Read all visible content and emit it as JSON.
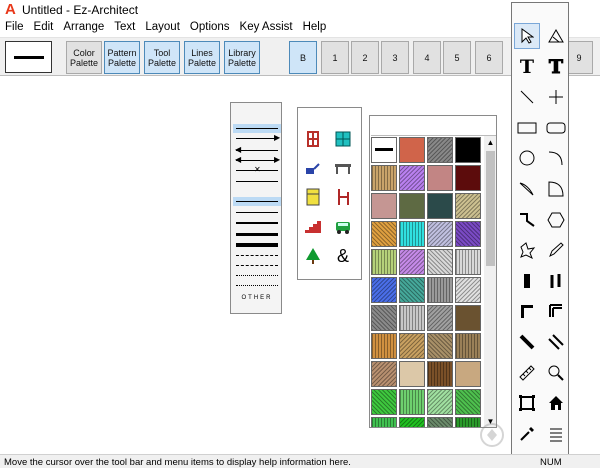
{
  "app": {
    "title": "Untitled - Ez-Architect",
    "icon_letter": "A"
  },
  "menu": [
    "File",
    "Edit",
    "Arrange",
    "Text",
    "Layout",
    "Options",
    "Key Assist",
    "Help"
  ],
  "toolbar": {
    "current_line_style": "thick-line",
    "palette_buttons": [
      {
        "label": "Color\nPalette",
        "selected": false
      },
      {
        "label": "Pattern\nPalette",
        "selected": true
      },
      {
        "label": "Tool\nPalette",
        "selected": true
      },
      {
        "label": "Lines\nPalette",
        "selected": true
      },
      {
        "label": "Library\nPalette",
        "selected": true
      }
    ],
    "layers": [
      {
        "label": "B",
        "selected": true
      },
      {
        "label": "1",
        "selected": false
      },
      {
        "label": "2",
        "selected": false
      },
      {
        "label": "3",
        "selected": false
      },
      {
        "label": "4",
        "selected": false
      },
      {
        "label": "5",
        "selected": false
      },
      {
        "label": "6",
        "selected": false
      },
      {
        "label": "9",
        "selected": false
      }
    ]
  },
  "lines_palette": {
    "other_label": "OTHER"
  },
  "library_palette": {
    "icons": [
      "door-icon",
      "window-icon",
      "sink-icon",
      "bench-icon",
      "refrigerator-icon",
      "chair-icon",
      "stairs-icon",
      "car-icon",
      "tree-icon",
      "ampersand-icon"
    ],
    "ampersand_text": "&"
  },
  "pattern_palette": {
    "colors": [
      "#ffffff",
      "#d0644a",
      "#888888",
      "#000000",
      "#c9a46a",
      "#b980f0",
      "#c28584",
      "#5c0c0c",
      "#c59693",
      "#5e6a43",
      "#2b4a4a",
      "#ccc090",
      "#e0a040",
      "#30e0e0",
      "#c0c0e0",
      "#7a4ac4",
      "#b5d17a",
      "#c58ae8",
      "#d8d8d8",
      "#d8d8d8",
      "#4a6ee8",
      "#45a89a",
      "#9a9a9a",
      "#e0e0e0",
      "#8a8a8a",
      "#c8c8c8",
      "#a0a0a0",
      "#6a5230",
      "#d09040",
      "#c8a060",
      "#a89068",
      "#9a8058",
      "#b89070",
      "#dcc8a8",
      "#7a5028",
      "#c8a880",
      "#3ec83e",
      "#6ed06e",
      "#a0e0a0",
      "#4ec04e",
      "#40c050",
      "#20c020",
      "#6a8a6a",
      "#2a9a2a"
    ],
    "patterned": [
      false,
      false,
      true,
      false,
      true,
      true,
      false,
      false,
      false,
      false,
      false,
      true,
      true,
      true,
      true,
      true,
      true,
      true,
      true,
      true,
      true,
      true,
      true,
      true,
      true,
      true,
      true,
      false,
      true,
      true,
      true,
      true,
      true,
      false,
      true,
      false,
      true,
      true,
      true,
      true,
      true,
      true,
      true,
      true
    ]
  },
  "tool_palette": {
    "tools": [
      "arrow-pointer-icon",
      "angle-icon",
      "text-tool-icon",
      "bold-text-icon",
      "diagonal-line-icon",
      "crosshair-icon",
      "rectangle-icon",
      "rounded-rectangle-icon",
      "circle-icon",
      "arc-icon",
      "ellipse-segment-icon",
      "quarter-pie-icon",
      "wall-corner-icon",
      "hexagon-icon",
      "freeform-icon",
      "pencil-icon",
      "thick-wall-icon",
      "double-wall-icon",
      "corner-wall-icon",
      "double-corner-icon",
      "thick-diagonal-icon",
      "double-diagonal-icon",
      "ruler-icon",
      "zoom-icon",
      "frame-icon",
      "house-icon",
      "eyedropper-icon",
      "list-icon"
    ],
    "text_glyph": "T"
  },
  "status": {
    "text": "Move the cursor over the tool bar and menu items to display help information here.",
    "indicator": "NUM"
  }
}
